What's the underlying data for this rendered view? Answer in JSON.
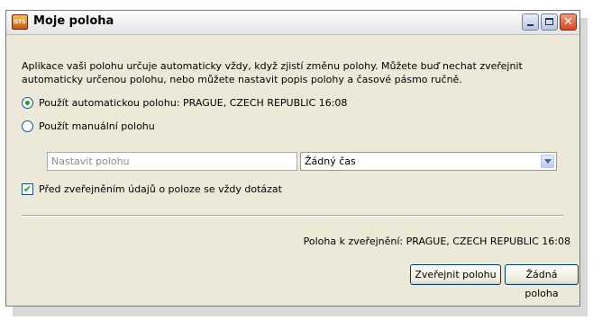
{
  "window": {
    "title": "Moje poloha",
    "icon_text": "GTS",
    "close_glyph": "✕"
  },
  "description": "Aplikace vaši polohu určuje automaticky vždy, když zjistí změnu polohy. Můžete buď nechat zveřejnit automaticky určenou polohu, nebo můžete nastavit popis polohy a časové pásmo ručně.",
  "options": {
    "auto_label": "Použít automatickou polohu: PRAGUE, CZECH REPUBLIC  16:08",
    "manual_label": "Použít manuální polohu",
    "selected": "auto"
  },
  "manual": {
    "location_placeholder": "Nastavit polohu",
    "time_value": "Žádný čas"
  },
  "confirm_checkbox": {
    "label": "Před zveřejněním údajů o poloze se vždy dotázat",
    "checked": true,
    "check_glyph": "✔"
  },
  "publish_status": "Poloha k zveřejnění: PRAGUE, CZECH REPUBLIC  16:08",
  "buttons": {
    "publish": "Zveřejnit polohu",
    "none": "Žádná poloha"
  },
  "colors": {
    "dialog_bg": "#ece9d8",
    "radio_check": "#21a121",
    "close_button": "#d5471e"
  }
}
